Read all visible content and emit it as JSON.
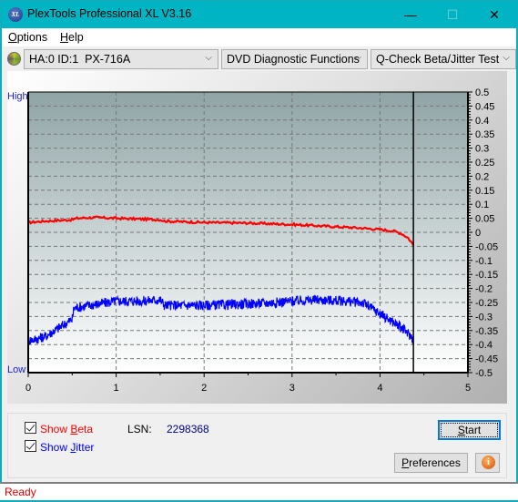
{
  "window": {
    "title": "PlexTools Professional XL V3.16",
    "app_icon_text": "XL",
    "controls": {
      "minimize": "—",
      "maximize": "☐",
      "close": "✕"
    }
  },
  "menu": {
    "items": [
      {
        "label": "Options",
        "accel": "O"
      },
      {
        "label": "Help",
        "accel": "H"
      }
    ]
  },
  "toolbar": {
    "drive_select": "HA:0 ID:1  PX-716A",
    "function_select": "DVD Diagnostic Functions",
    "test_select": "Q-Check Beta/Jitter Test",
    "dropdown_glyph": "⌵"
  },
  "chart_labels": {
    "high": "High",
    "low": "Low"
  },
  "chart_data": {
    "type": "line",
    "title": "",
    "xlabel": "",
    "ylabel": "",
    "xlim": [
      0,
      5
    ],
    "ylim": [
      -0.5,
      0.5
    ],
    "x_ticks": [
      "0",
      "1",
      "2",
      "3",
      "4",
      "5"
    ],
    "y_ticks": [
      "0.5",
      "0.45",
      "0.4",
      "0.35",
      "0.3",
      "0.25",
      "0.2",
      "0.15",
      "0.1",
      "0.05",
      "0",
      "-0.05",
      "-0.1",
      "-0.15",
      "-0.2",
      "-0.25",
      "-0.3",
      "-0.35",
      "-0.4",
      "-0.45",
      "-0.5"
    ],
    "grid": true,
    "end_marker_x": 4.38,
    "series": [
      {
        "name": "Beta",
        "color": "#ff0000",
        "x": [
          0,
          0.2,
          0.5,
          0.55,
          0.75,
          1.0,
          1.5,
          1.55,
          2.0,
          2.5,
          3.0,
          3.5,
          3.8,
          4.0,
          4.15,
          4.25,
          4.32,
          4.38
        ],
        "y": [
          0.035,
          0.04,
          0.045,
          0.05,
          0.053,
          0.05,
          0.045,
          0.04,
          0.035,
          0.033,
          0.028,
          0.02,
          0.015,
          0.01,
          0.005,
          -0.005,
          -0.02,
          -0.045
        ]
      },
      {
        "name": "Jitter",
        "color": "#0000ff",
        "x": [
          0,
          0.1,
          0.2,
          0.3,
          0.4,
          0.5,
          0.52,
          0.7,
          1.0,
          1.3,
          1.5,
          1.55,
          2.0,
          2.5,
          2.8,
          3.0,
          3.3,
          3.6,
          3.8,
          3.9,
          4.0,
          4.1,
          4.2,
          4.3,
          4.38
        ],
        "y": [
          -0.385,
          -0.38,
          -0.37,
          -0.35,
          -0.33,
          -0.31,
          -0.27,
          -0.26,
          -0.245,
          -0.245,
          -0.24,
          -0.26,
          -0.26,
          -0.255,
          -0.25,
          -0.245,
          -0.24,
          -0.245,
          -0.25,
          -0.27,
          -0.29,
          -0.31,
          -0.33,
          -0.355,
          -0.38
        ]
      }
    ]
  },
  "options": {
    "show_beta": {
      "label": "Show Beta",
      "accel": "B",
      "checked": true,
      "color": "#ff0000"
    },
    "show_jitter": {
      "label": "Show Jitter",
      "accel": "J",
      "checked": true,
      "color": "#0000ff"
    }
  },
  "lsn": {
    "label": "LSN:",
    "value": "2298368"
  },
  "buttons": {
    "start": "Start",
    "preferences": "Preferences",
    "info": "i"
  },
  "status": {
    "text": "Ready"
  }
}
